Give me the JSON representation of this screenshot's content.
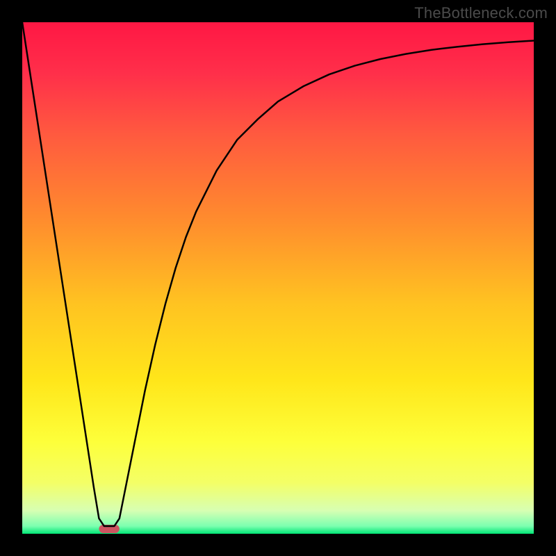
{
  "watermark": "TheBottleneck.com",
  "chart_data": {
    "type": "line",
    "title": "",
    "xlabel": "",
    "ylabel": "",
    "xlim": [
      0,
      100
    ],
    "ylim": [
      0,
      100
    ],
    "grid": false,
    "legend": false,
    "annotations": [],
    "curve": {
      "name": "bottleneck-curve",
      "x": [
        0,
        2,
        4,
        6,
        8,
        10,
        12,
        14,
        15,
        16,
        17,
        18,
        19,
        20,
        22,
        24,
        26,
        28,
        30,
        32,
        34,
        38,
        42,
        46,
        50,
        55,
        60,
        65,
        70,
        75,
        80,
        85,
        90,
        95,
        100
      ],
      "y": [
        100,
        87,
        74,
        61,
        48,
        35,
        22,
        9,
        3,
        1.5,
        1.5,
        1.5,
        3,
        8,
        18,
        28,
        37,
        45,
        52,
        58,
        63,
        71,
        77,
        81,
        84.5,
        87.5,
        89.8,
        91.5,
        92.8,
        93.8,
        94.6,
        95.2,
        95.7,
        96.1,
        96.4
      ]
    },
    "marker": {
      "name": "bottleneck-marker",
      "x_center": 17,
      "width": 4,
      "color": "#cd5360"
    },
    "gradient_stops": [
      {
        "offset": 0.0,
        "color": "#ff1744"
      },
      {
        "offset": 0.1,
        "color": "#ff2f4a"
      },
      {
        "offset": 0.22,
        "color": "#ff5a3f"
      },
      {
        "offset": 0.38,
        "color": "#ff8a2e"
      },
      {
        "offset": 0.55,
        "color": "#ffc321"
      },
      {
        "offset": 0.7,
        "color": "#ffe61a"
      },
      {
        "offset": 0.82,
        "color": "#fdff3a"
      },
      {
        "offset": 0.9,
        "color": "#f4ff66"
      },
      {
        "offset": 0.955,
        "color": "#d7ffb3"
      },
      {
        "offset": 0.985,
        "color": "#7cffb0"
      },
      {
        "offset": 1.0,
        "color": "#00e676"
      }
    ]
  }
}
